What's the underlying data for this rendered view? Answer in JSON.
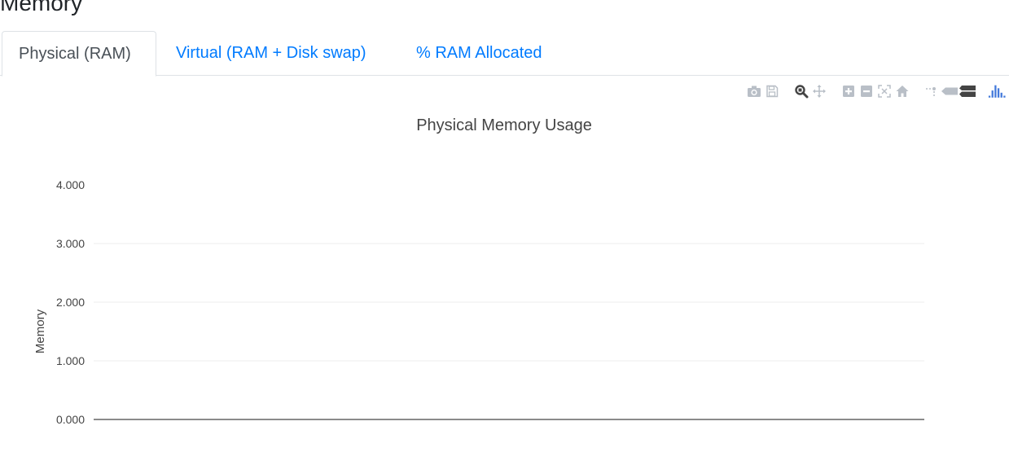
{
  "page": {
    "title": "Memory"
  },
  "tabs": [
    {
      "label": "Physical (RAM)",
      "active": true
    },
    {
      "label": "Virtual (RAM + Disk swap)",
      "active": false
    },
    {
      "label": "% RAM Allocated",
      "active": false
    }
  ],
  "modebar": {
    "icons": [
      "camera-icon",
      "save-icon",
      "zoom-icon",
      "pan-icon",
      "zoom-in-icon",
      "zoom-out-icon",
      "autoscale-icon",
      "reset-axes-icon",
      "spike-lines-icon",
      "hover-closest-icon",
      "hover-compare-icon",
      "plotly-logo-icon"
    ],
    "active_color": "#444444",
    "inactive_color": "#b9bfc7",
    "logo_color": "#447adb"
  },
  "chart_data": {
    "type": "line",
    "title": "Physical Memory Usage",
    "xlabel": "",
    "ylabel": "Memory",
    "ylim": [
      0,
      4
    ],
    "yticks": [
      "0.000",
      "1.000",
      "2.000",
      "3.000",
      "4.000"
    ],
    "ytick_values": [
      0,
      1,
      2,
      3,
      4
    ],
    "grid": true,
    "series": []
  }
}
